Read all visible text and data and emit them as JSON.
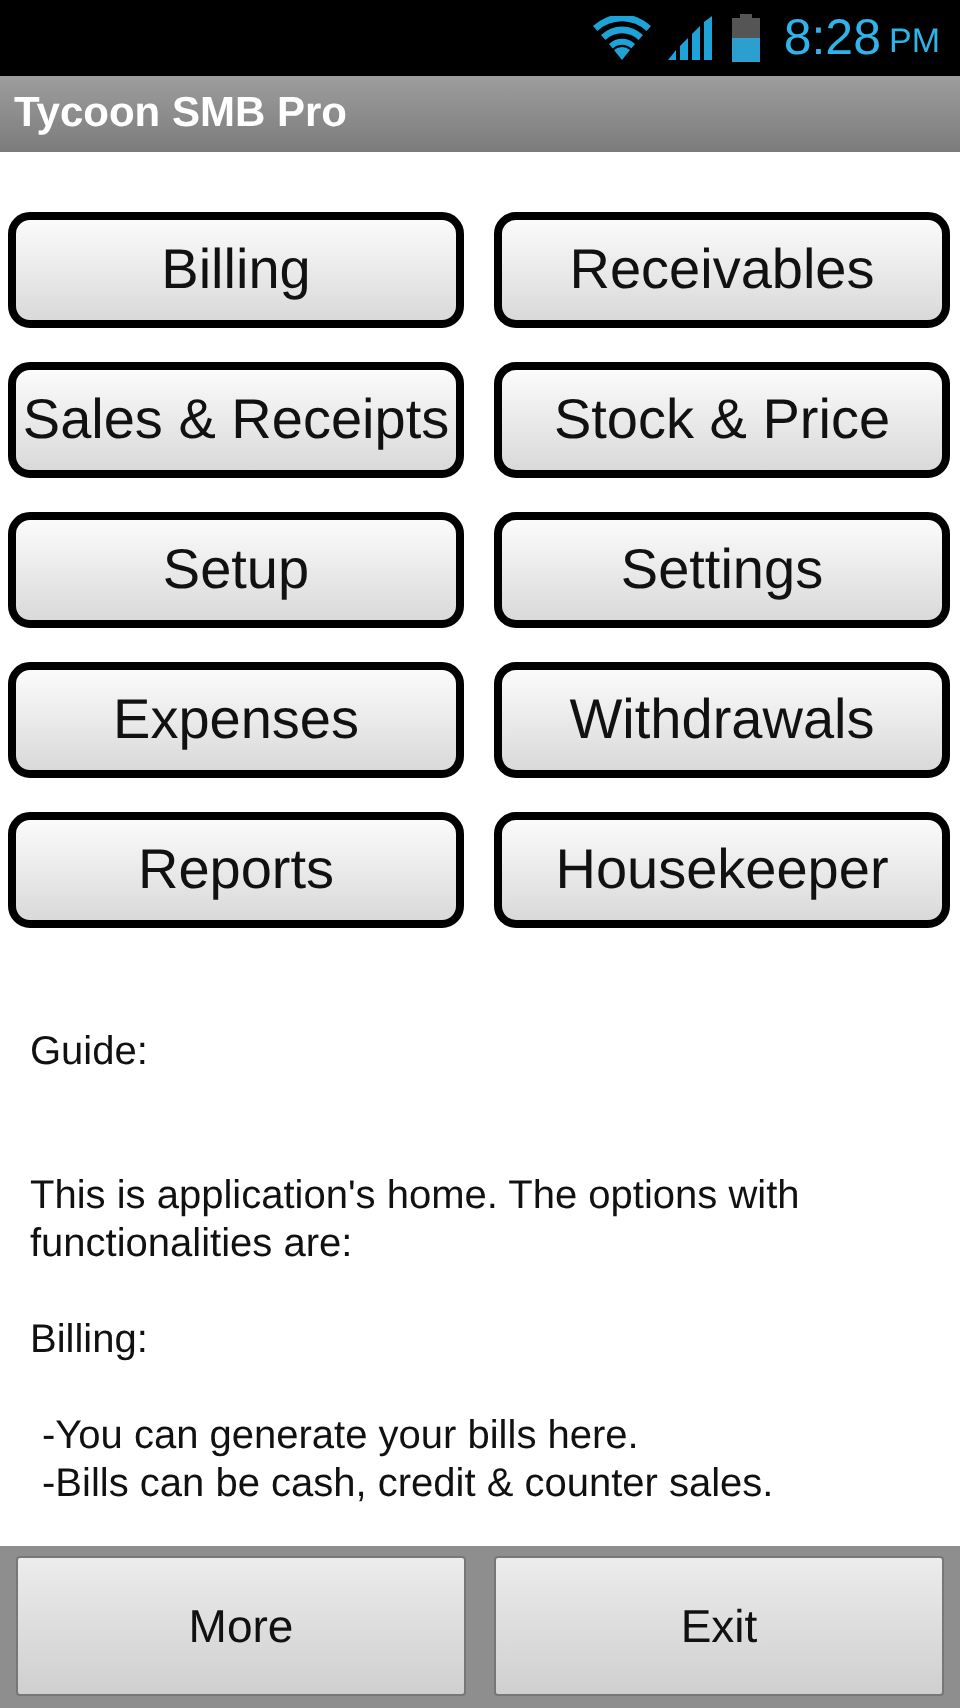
{
  "status_bar": {
    "time": "8:28",
    "period": "PM"
  },
  "title_bar": {
    "title": "Tycoon SMB Pro"
  },
  "menu_buttons": [
    "Billing",
    "Receivables",
    "Sales & Receipts",
    "Stock & Price",
    "Setup",
    "Settings",
    "Expenses",
    "Withdrawals",
    "Reports",
    "Housekeeper"
  ],
  "guide": [
    {
      "kind": "heading",
      "text": "Guide:"
    },
    {
      "kind": "paragraph",
      "text": "This is application's home. The options with functionalities are:"
    },
    {
      "kind": "paragraph",
      "text": "Billing:"
    },
    {
      "kind": "bullet",
      "text": "-You can generate your bills here."
    },
    {
      "kind": "bullet",
      "text": "-Bills can be cash, credit & counter sales."
    }
  ],
  "bottom_buttons": [
    "More",
    "Exit"
  ]
}
